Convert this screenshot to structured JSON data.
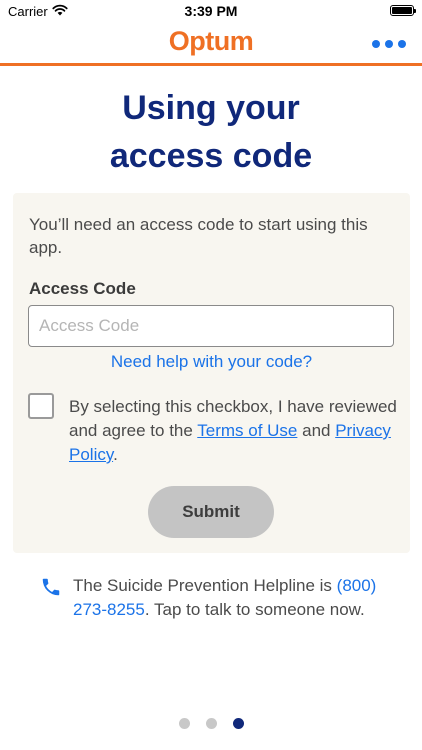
{
  "status_bar": {
    "carrier": "Carrier",
    "time": "3:39 PM",
    "wifi_icon": "wifi-icon",
    "battery_icon": "battery-icon"
  },
  "header": {
    "brand": "Optum",
    "brand_color": "#ef7024",
    "menu_icon": "more-horizontal-icon"
  },
  "title": {
    "line1": "Using your",
    "line2": "access code"
  },
  "form": {
    "intro": "You’ll need an access code to start using this app.",
    "access_code_label": "Access Code",
    "access_code_placeholder": "Access Code",
    "access_code_value": "",
    "help_link": "Need help with your code?",
    "agreement": {
      "checked": false,
      "prefix": "By selecting this checkbox, I have reviewed and agree to the ",
      "terms_link": "Terms of Use",
      "middle": " and ",
      "privacy_link": "Privacy Policy",
      "suffix": "."
    },
    "submit_label": "Submit"
  },
  "helpline": {
    "icon": "phone-icon",
    "prefix": "The Suicide Prevention Helpline is ",
    "phone": "(800) 273-8255",
    "suffix": ". Tap to talk to someone now."
  },
  "pager": {
    "count": 3,
    "active_index": 2
  },
  "colors": {
    "accent_blue": "#1b73e8",
    "title_navy": "#10287a",
    "card_bg": "#f8f6f0",
    "button_disabled": "#c4c4c4"
  }
}
